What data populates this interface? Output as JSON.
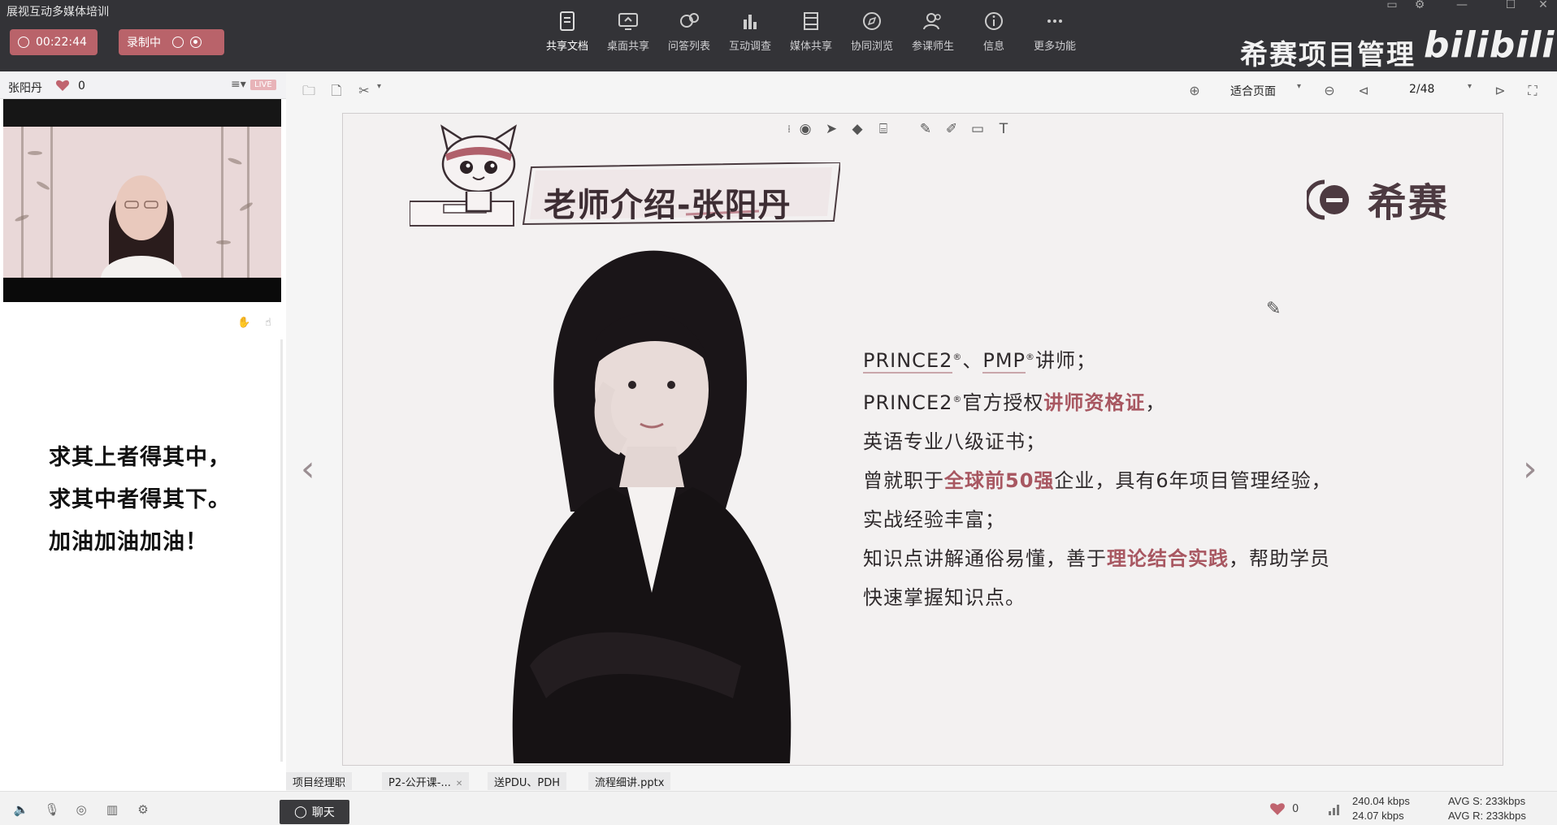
{
  "window": {
    "title": "展视互动多媒体培训"
  },
  "session": {
    "timer": "00:22:44",
    "recording_label": "录制中"
  },
  "toolbar": {
    "items": [
      {
        "label": "共享文档",
        "icon": "doc-icon"
      },
      {
        "label": "桌面共享",
        "icon": "desktop-share-icon"
      },
      {
        "label": "问答列表",
        "icon": "qa-icon"
      },
      {
        "label": "互动调查",
        "icon": "survey-icon"
      },
      {
        "label": "媒体共享",
        "icon": "media-icon"
      },
      {
        "label": "协同浏览",
        "icon": "browse-icon"
      },
      {
        "label": "参课师生",
        "icon": "people-icon"
      },
      {
        "label": "信息",
        "icon": "info-icon"
      },
      {
        "label": "更多功能",
        "icon": "more-icon"
      }
    ]
  },
  "brand": {
    "name": "希赛项目管理",
    "logo": "bilibili"
  },
  "left_panel": {
    "presenter": "张阳丹",
    "likes": "0",
    "live_badge": "LIVE",
    "motto": [
      "求其上者得其中，",
      "求其中者得其下。",
      "加油加油加油！"
    ]
  },
  "doc_toolbar": {
    "fit_mode": "适合页面",
    "page": "2/48"
  },
  "slide": {
    "title": "老师介绍-张阳丹",
    "brand": "希赛",
    "bio": {
      "l1_a": "PRINCE2",
      "l1_reg": "®",
      "l1_b": "、",
      "l1_c": "PMP",
      "l1_reg2": "®",
      "l1_d": "讲师；",
      "l2_a": "PRINCE2",
      "l2_reg": "®",
      "l2_b": "官方授权",
      "l2_hl": "讲师资格证",
      "l2_c": "，",
      "l3": "英语专业八级证书；",
      "l4_a": "曾就职于",
      "l4_hl": "全球前50强",
      "l4_b": "企业，具有6年项目管理经验，",
      "l5": "实战经验丰富；",
      "l6_a": "知识点讲解通俗易懂，善于",
      "l6_hl": "理论结合实践",
      "l6_b": "，帮助学员",
      "l7": "快速掌握知识点。"
    }
  },
  "doc_tabs": [
    "项目经理职",
    "P2-公开课-...",
    "送PDU、PDH",
    "流程细讲.pptx"
  ],
  "statusbar": {
    "chat_label": "聊天",
    "likes": "0",
    "send_rate": "240.04 kbps",
    "recv_rate": "24.07 kbps",
    "avg_s": "AVG S: 233kbps",
    "avg_r": "AVG R: 233kbps"
  },
  "colors": {
    "accent": "#b9636a",
    "highlight": "#a85761",
    "topbar": "#333337"
  }
}
